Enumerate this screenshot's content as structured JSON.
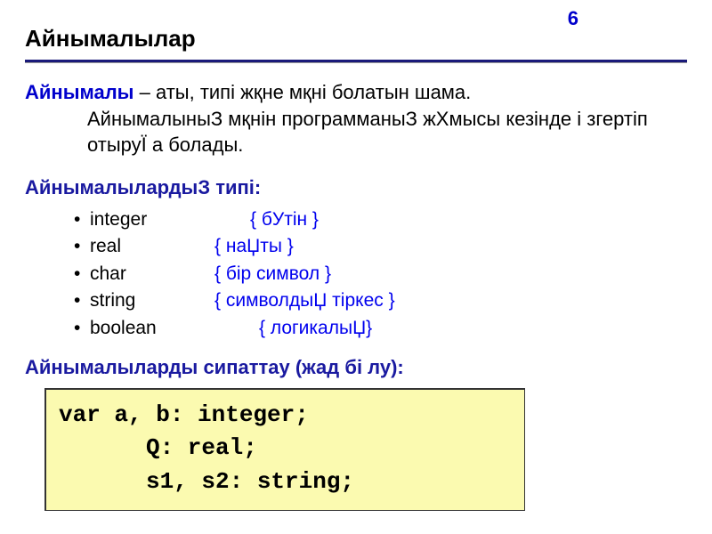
{
  "page_number": "6",
  "title": "Айнымалылар",
  "definition": {
    "term": "Айнымалы",
    "dash": " – ",
    "text_line1": "аты, типі жқне мқні болатын шама.",
    "text_cont": "АйнымалыныЗ мқнін программаныЗ жХмысы кезінде і згертіп отыруЇ а болады."
  },
  "types_heading": "АйнымалылардыЗ типі:",
  "types": [
    {
      "name": "integer",
      "comment": "{ бУтін }",
      "w": "w1"
    },
    {
      "name": "real",
      "comment": "{ наЏты }",
      "w": "w2"
    },
    {
      "name": "char",
      "comment": "{ бір символ }",
      "w": "w3"
    },
    {
      "name": "string",
      "comment": "{ символдыЏ тіркес }",
      "w": "w4"
    },
    {
      "name": "boolean",
      "comment": "{ логикалыЏ}",
      "w": "w5"
    }
  ],
  "declare_heading": "Айнымалыларды сипаттау (жад бі лу):",
  "code": {
    "line1": "var  a, b: integer;",
    "line2": "Q: real;",
    "line3": "s1, s2: string;"
  }
}
